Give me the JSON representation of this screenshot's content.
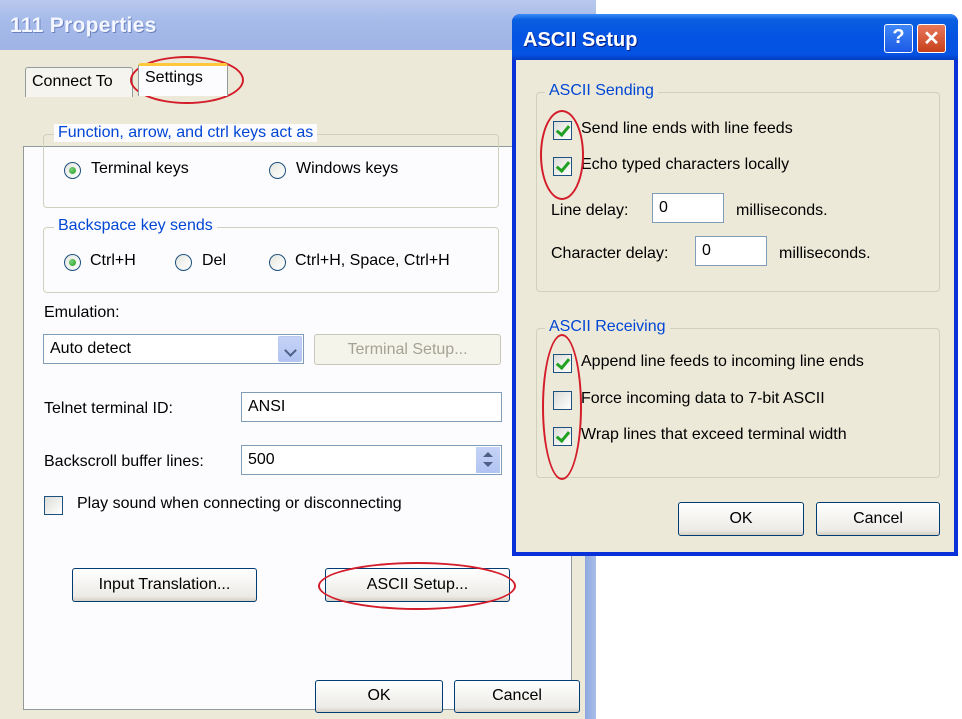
{
  "main_window": {
    "title": "111 Properties",
    "tabs": [
      {
        "label": "Connect To"
      },
      {
        "label": "Settings"
      }
    ],
    "keys_group": {
      "legend": "Function, arrow, and ctrl keys act as",
      "options": [
        {
          "label": "Terminal keys",
          "selected": true
        },
        {
          "label": "Windows keys",
          "selected": false
        }
      ]
    },
    "backspace_group": {
      "legend": "Backspace key sends",
      "options": [
        {
          "label": "Ctrl+H",
          "selected": true
        },
        {
          "label": "Del",
          "selected": false
        },
        {
          "label": "Ctrl+H, Space, Ctrl+H",
          "selected": false
        }
      ]
    },
    "emulation": {
      "label": "Emulation:",
      "value": "Auto detect",
      "terminal_setup_label": "Terminal Setup..."
    },
    "telnet": {
      "label": "Telnet terminal ID:",
      "value": "ANSI"
    },
    "backscroll": {
      "label": "Backscroll buffer lines:",
      "value": "500"
    },
    "play_sound": {
      "label": "Play sound when connecting or disconnecting",
      "checked": false
    },
    "input_translation_label": "Input Translation...",
    "ascii_setup_label": "ASCII Setup...",
    "ok_label": "OK",
    "cancel_label": "Cancel"
  },
  "ascii_dialog": {
    "title": "ASCII Setup",
    "help_label": "?",
    "close_label": "✕",
    "sending": {
      "legend": "ASCII Sending",
      "send_line_ends": {
        "label": "Send line ends with line feeds",
        "checked": true
      },
      "echo_typed": {
        "label": "Echo typed characters locally",
        "checked": true
      },
      "line_delay": {
        "label": "Line delay:",
        "value": "0",
        "unit": "milliseconds."
      },
      "char_delay": {
        "label": "Character delay:",
        "value": "0",
        "unit": "milliseconds."
      }
    },
    "receiving": {
      "legend": "ASCII Receiving",
      "append_line_feeds": {
        "label": "Append line feeds to incoming line ends",
        "checked": true
      },
      "force_7bit": {
        "label": "Force incoming data to 7-bit ASCII",
        "checked": false
      },
      "wrap_lines": {
        "label": "Wrap lines that exceed terminal width",
        "checked": true
      }
    },
    "ok_label": "OK",
    "cancel_label": "Cancel"
  },
  "colors": {
    "annotation_red": "#d41d2a",
    "group_legend_blue": "#0046d5",
    "xp_title_blue": "#0553e3",
    "check_green": "#21a121"
  }
}
